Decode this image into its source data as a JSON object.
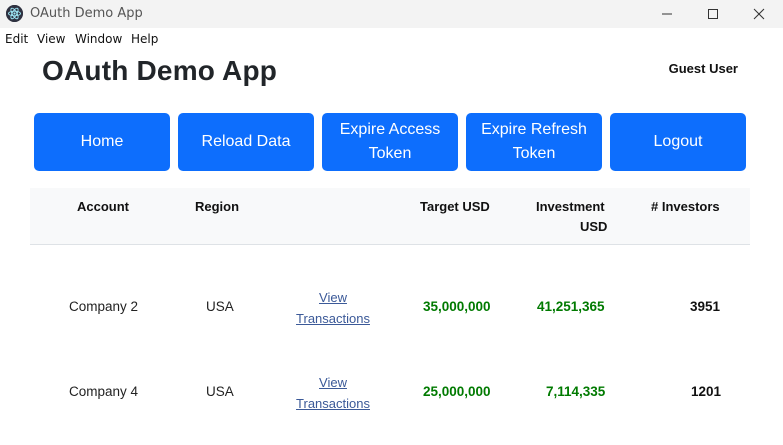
{
  "window": {
    "title": "OAuth Demo App"
  },
  "menu": {
    "items": [
      "Edit",
      "View",
      "Window",
      "Help"
    ]
  },
  "header": {
    "app_title": "OAuth Demo App",
    "user": "Guest User"
  },
  "buttons": {
    "home": "Home",
    "reload": "Reload Data",
    "expire_access": "Expire Access Token",
    "expire_refresh": "Expire Refresh Token",
    "logout": "Logout"
  },
  "table": {
    "headers": {
      "account": "Account",
      "region": "Region",
      "target": "Target USD",
      "investment_line1": "Investment",
      "investment_line2": "USD",
      "investors": "# Investors"
    },
    "rows": [
      {
        "account": "Company 2",
        "region": "USA",
        "link_line1": "View",
        "link_line2": "Transactions",
        "target": "35,000,000",
        "investment": "41,251,365",
        "investors": "3951"
      },
      {
        "account": "Company 4",
        "region": "USA",
        "link_line1": "View",
        "link_line2": "Transactions",
        "target": "25,000,000",
        "investment": "7,114,335",
        "investors": "1201"
      }
    ]
  },
  "colors": {
    "primary": "#0d6efd",
    "amount_green": "#007a00",
    "link": "#3b5998"
  },
  "icons": {
    "app": "electron-icon",
    "minimize": "minimize-icon",
    "maximize": "maximize-icon",
    "close": "close-icon"
  }
}
